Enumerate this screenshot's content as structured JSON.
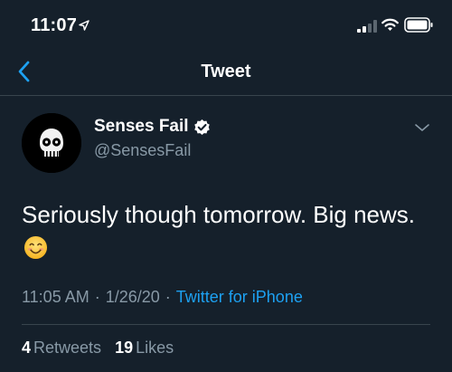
{
  "status_bar": {
    "time": "11:07"
  },
  "nav": {
    "title": "Tweet"
  },
  "tweet": {
    "author_name": "Senses Fail",
    "author_handle": "@SensesFail",
    "text": "Seriously though tomorrow. Big news.",
    "emoji": "smiling-face-icon",
    "time": "11:05 AM",
    "date": "1/26/20",
    "separator": "·",
    "source": "Twitter for iPhone",
    "retweets_count": "4",
    "retweets_label": "Retweets",
    "likes_count": "19",
    "likes_label": "Likes"
  },
  "colors": {
    "background": "#15202b",
    "accent": "#1da1f2",
    "secondary_text": "#8899a6",
    "divider": "#38444d"
  }
}
